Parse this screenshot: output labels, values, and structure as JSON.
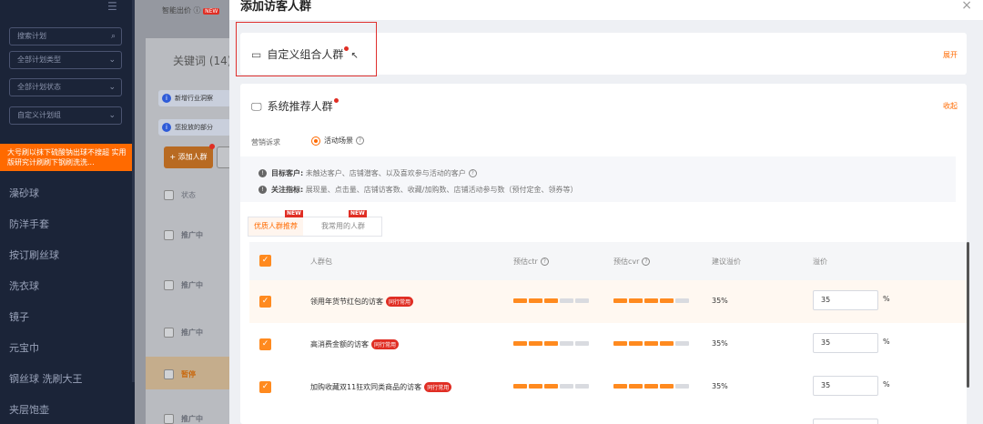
{
  "sidebar": {
    "top_icon": "☰",
    "selects": [
      "搜索计划",
      "全部计划类型",
      "全部计划状态",
      "自定义计划组"
    ],
    "alert": "大号刷以抹下硫酸钠出球不搜超 实用版研究计刷刷下钢刷洗洗...",
    "items": [
      "澡砂球",
      "防洋手套",
      "按订刷丝球",
      "洗衣球",
      "镜子",
      "元宝巾",
      "钢丝球 洗刷大王",
      "夹层饱壶"
    ]
  },
  "middle": {
    "top_text": "智能出价",
    "top_badge": "NEW",
    "tab": "关键词 (14)",
    "info1": "新增行业洞察",
    "info2": "您投放的部分",
    "add_button": "+ 添加人群",
    "header_status": "状态",
    "rows": [
      {
        "status": "推广中"
      },
      {
        "status": "推广中"
      },
      {
        "status": "推广中"
      },
      {
        "status": "暂停"
      },
      {
        "status": "推广中"
      }
    ]
  },
  "modal": {
    "title": "添加访客人群",
    "close": "×",
    "custom_panel": {
      "title": "自定义组合人群",
      "action": "展开"
    },
    "system_panel": {
      "title": "系统推荐人群",
      "action": "收起"
    },
    "marketing_label": "营销诉求",
    "marketing_option": "活动场景",
    "tip1_label": "目标客户:",
    "tip1_text": "未触达客户、店铺潜客、以及喜欢参与活动的客户",
    "tip2_label": "关注指标:",
    "tip2_text": "展现量、点击量、店铺访客数、收藏/加购数、店铺活动参与数（预付定金、领券等）",
    "tabs": [
      {
        "label": "优质人群推荐",
        "badge": "NEW",
        "active": true
      },
      {
        "label": "我常用的人群",
        "badge": "NEW",
        "active": false
      }
    ],
    "columns": [
      "人群包",
      "预估ctr",
      "预估cvr",
      "建议溢价",
      "溢价"
    ],
    "rows": [
      {
        "name": "领用年货节红包的访客",
        "tag": "同行常用",
        "suggest": "35%",
        "value": "35",
        "unit": "%",
        "ctr_filled": 3,
        "cvr_filled": 4
      },
      {
        "name": "高消费金额的访客",
        "tag": "同行常用",
        "suggest": "35%",
        "value": "35",
        "unit": "%",
        "ctr_filled": 3,
        "cvr_filled": 4
      },
      {
        "name": "加购收藏双11狂欢同类商品的访客",
        "tag": "同行常用",
        "suggest": "35%",
        "value": "35",
        "unit": "%",
        "ctr_filled": 3,
        "cvr_filled": 4
      }
    ]
  },
  "colors": {
    "accent": "#ff6a00",
    "bar_filled": "#ff8a1f",
    "bar_empty": "#d9dbe0",
    "red": "#e02e24"
  }
}
